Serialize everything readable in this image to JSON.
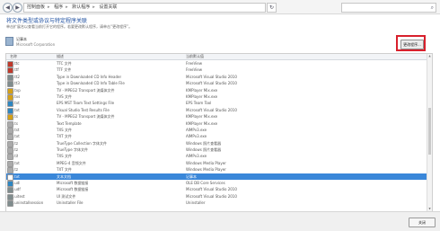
{
  "breadcrumb": {
    "items": [
      "控制面板",
      "程序",
      "默认程序",
      "设置关联"
    ]
  },
  "header": {
    "title": "将文件类型或协议与特定程序关联",
    "description": "单击扩展名以查看当前打开它的程序。若要更改默认程序，请单击“更改程序”。"
  },
  "selected_program": {
    "name": "记事本",
    "vendor": "Microsoft Corporation"
  },
  "buttons": {
    "change_program": "更改程序...",
    "close": "关闭"
  },
  "table": {
    "columns": [
      "名称",
      "描述",
      "当前默认值"
    ],
    "rows": [
      {
        "ext": ".ttc",
        "desc": "TTC 文件",
        "default": "FreeView",
        "icon_color": "#c0392b"
      },
      {
        "ext": ".ttf",
        "desc": "TTF 文件",
        "default": "FreeView",
        "icon_color": "#c0392b"
      },
      {
        "ext": ".tt2",
        "desc": "Type in Downloaded CD Info Header",
        "default": "Microsoft Visual Studio 2010",
        "icon_color": "#7f8c8d"
      },
      {
        "ext": ".tt3",
        "desc": "Type in Downloaded CD Info Table File",
        "default": "Microsoft Visual Studio 2010",
        "icon_color": "#7f8c8d"
      },
      {
        "ext": ".tvp",
        "desc": "TV - MPEG2 Transport 流媒体文件",
        "default": "KMPlayer Mix.exe",
        "icon_color": "#d4a017"
      },
      {
        "ext": ".tvs",
        "desc": "TVS 文件",
        "default": "KMPlayer Mix.exe",
        "icon_color": "#d4a017"
      },
      {
        "ext": ".tvt",
        "desc": "EPS MST Team Text Settings File",
        "default": "EPS Team Tool",
        "icon_color": "#2e86c1"
      },
      {
        "ext": ".tvt",
        "desc": "Visual Studio Test Results File",
        "default": "Microsoft Visual Studio 2010",
        "icon_color": "#2e86c1"
      },
      {
        "ext": ".ts",
        "desc": "TV - MPEG2 Transport 流媒体文件",
        "default": "KMPlayer Mix.exe",
        "icon_color": "#d4a017"
      },
      {
        "ext": ".ts",
        "desc": "Text Template",
        "default": "KMPlayer Mix.exe",
        "icon_color": "#aaaaaa"
      },
      {
        "ext": ".tst",
        "desc": "TXS 文件",
        "default": "AIMPv3.exe",
        "icon_color": "#aaaaaa"
      },
      {
        "ext": ".txt",
        "desc": "TXT 文件",
        "default": "AIMPv3.exe",
        "icon_color": "#aaaaaa"
      },
      {
        "ext": ".tz",
        "desc": "TrueType Collection 字体文件",
        "default": "Windows 照片查看器",
        "icon_color": "#aaaaaa"
      },
      {
        "ext": ".tz",
        "desc": "TrueType 字体文件",
        "default": "Windows 照片查看器",
        "icon_color": "#aaaaaa"
      },
      {
        "ext": ".tif",
        "desc": "TXS 文件",
        "default": "AIMPv3.exe",
        "icon_color": "#aaaaaa"
      },
      {
        "ext": ".txt",
        "desc": "MPEG-4 音频文件",
        "default": "Windows Media Player",
        "icon_color": "#aaaaaa"
      },
      {
        "ext": ".tz",
        "desc": "TXT 文件",
        "default": "Windows Media Player",
        "icon_color": "#aaaaaa"
      },
      {
        "ext": ".txt",
        "desc": "文本文档",
        "default": "记事本",
        "icon_color": "#ffffff"
      },
      {
        "ext": ".udl",
        "desc": "Microsoft 数据链接",
        "default": "OLE DB Core Services",
        "icon_color": "#2e86c1"
      },
      {
        "ext": ".udf",
        "desc": "Microsoft 数据链接",
        "default": "Microsoft Visual Studio 2010",
        "icon_color": "#7f8c8d"
      },
      {
        "ext": ".uitest",
        "desc": "UI 测试文件",
        "default": "Microsoft Visual Studio 2010",
        "icon_color": "#7f8c8d"
      },
      {
        "ext": ".uninstallsession",
        "desc": "Uninstaller File",
        "default": "Uninstaller",
        "icon_color": "#7f8c8d"
      }
    ],
    "selected_index": 17
  },
  "colors": {
    "title_blue": "#1e4fa0",
    "selection": "#3a87d9",
    "highlight_box": "#d8202c"
  }
}
